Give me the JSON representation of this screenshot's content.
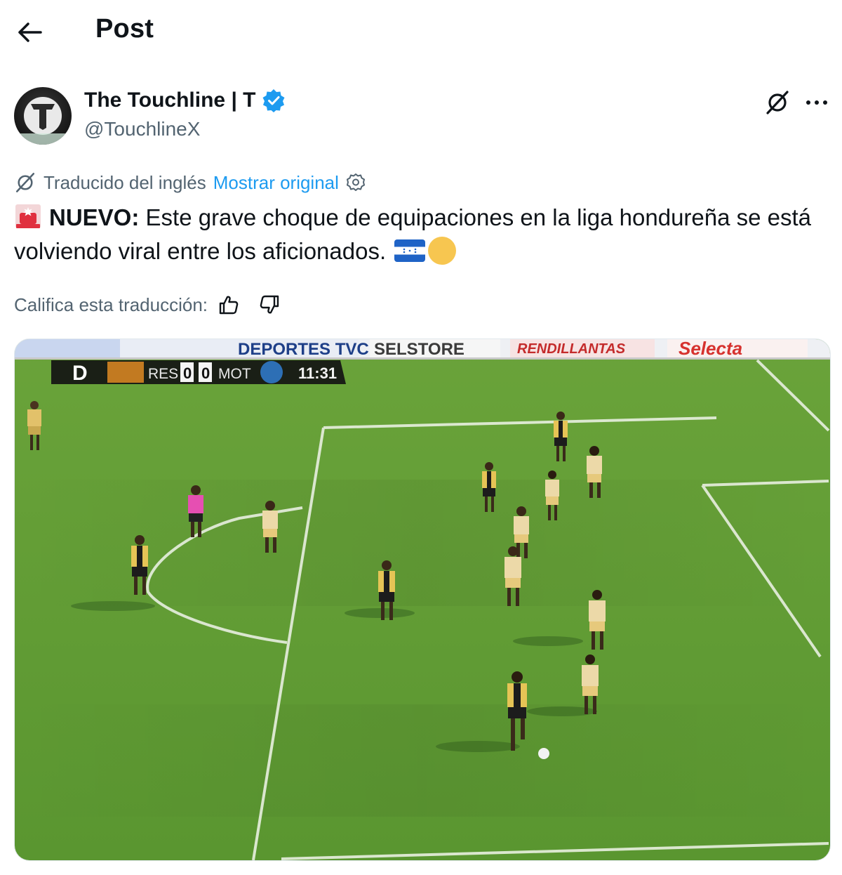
{
  "header": {
    "title": "Post"
  },
  "author": {
    "display_name": "The Touchline | T",
    "handle": "@TouchlineX",
    "avatar_letter": "T"
  },
  "translation": {
    "label": "Traducido del inglés",
    "show_original": "Mostrar original"
  },
  "tweet": {
    "bold_prefix": "NUEVO:",
    "body": "Este grave choque de equipaciones en la liga hondureña se está volviendo viral entre los aficionados."
  },
  "rating": {
    "label": "Califica esta traducción:"
  },
  "media": {
    "scoreboard": {
      "channel": "D",
      "home": "RES",
      "home_score": "0",
      "away_score": "0",
      "away": "MOT",
      "clock": "11:31"
    },
    "ads": [
      "DEPORTES TVC",
      "SELSTORE",
      "RENDILLANTAS",
      "Selecta"
    ]
  },
  "colors": {
    "accent": "#1d9bf0",
    "muted": "#536471",
    "pitch": "#5f9a32"
  }
}
